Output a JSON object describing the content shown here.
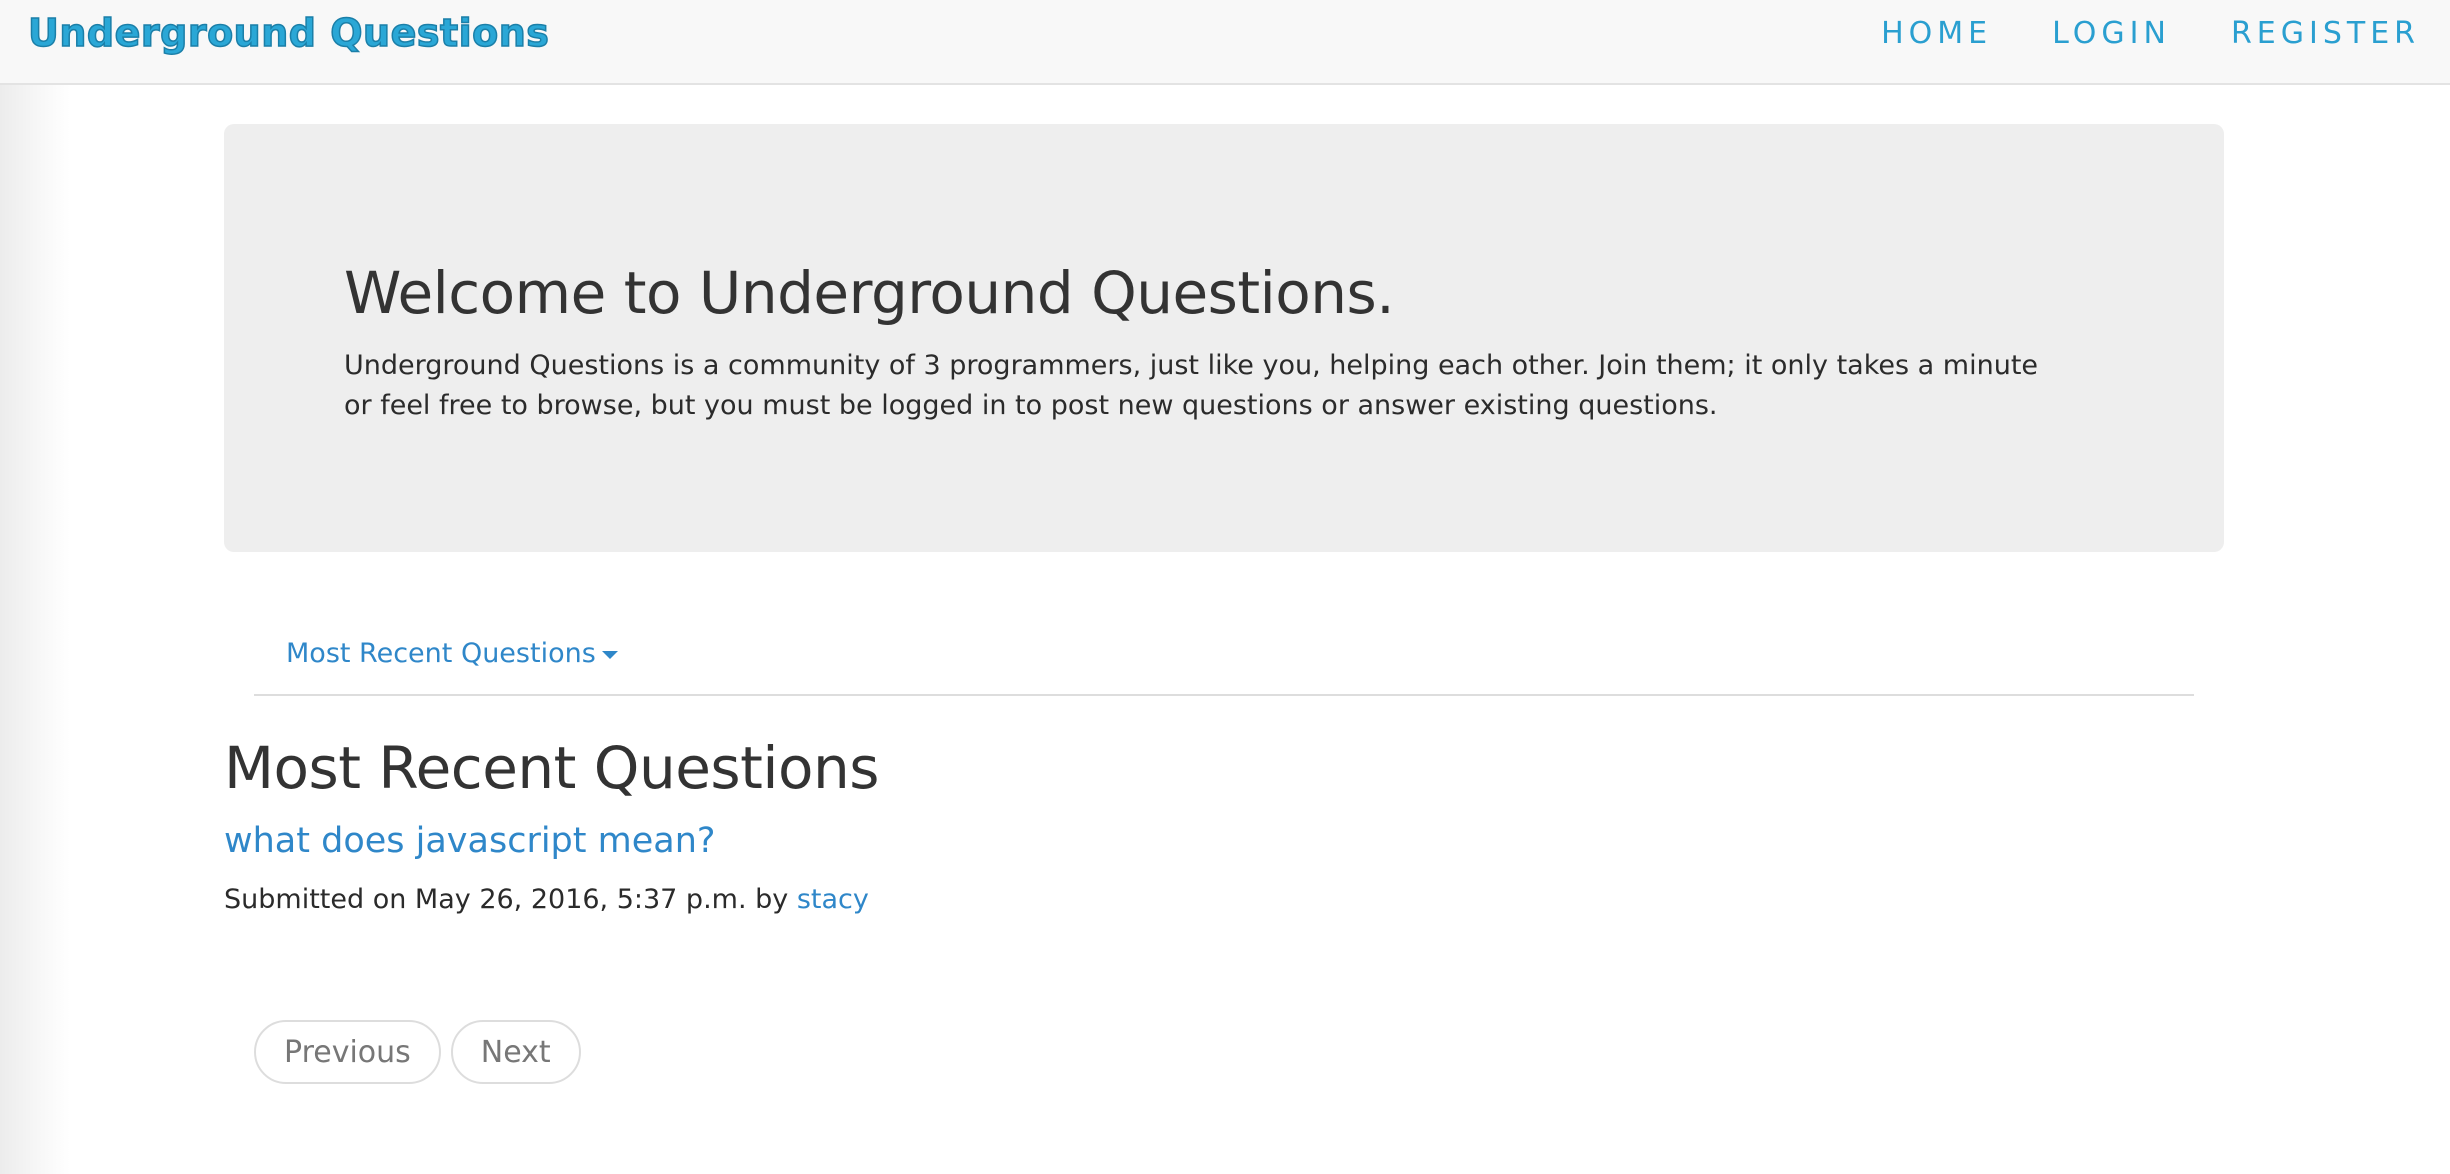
{
  "navbar": {
    "brand": "Underground Questions",
    "links": [
      {
        "label": "HOME"
      },
      {
        "label": "LOGIN"
      },
      {
        "label": "REGISTER"
      }
    ]
  },
  "jumbotron": {
    "title": "Welcome to Underground Questions.",
    "text": "Underground Questions is a community of 3 programmers, just like you, helping each other. Join them; it only takes a minute or feel free to browse, but you must be logged in to post new questions or answer existing questions."
  },
  "tabs": {
    "dropdown_label": "Most Recent Questions"
  },
  "section": {
    "title": "Most Recent Questions",
    "questions": [
      {
        "title": "what does javascript mean?",
        "submitted_prefix": "Submitted on May 26, 2016, 5:37 p.m. by ",
        "author": "stacy"
      }
    ]
  },
  "pager": {
    "previous_label": "Previous",
    "next_label": "Next"
  },
  "colors": {
    "accent": "#2f87c9",
    "brand": "#2aa7d6",
    "jumbotron_bg": "#eeeeee",
    "navbar_bg": "#f8f8f8"
  }
}
